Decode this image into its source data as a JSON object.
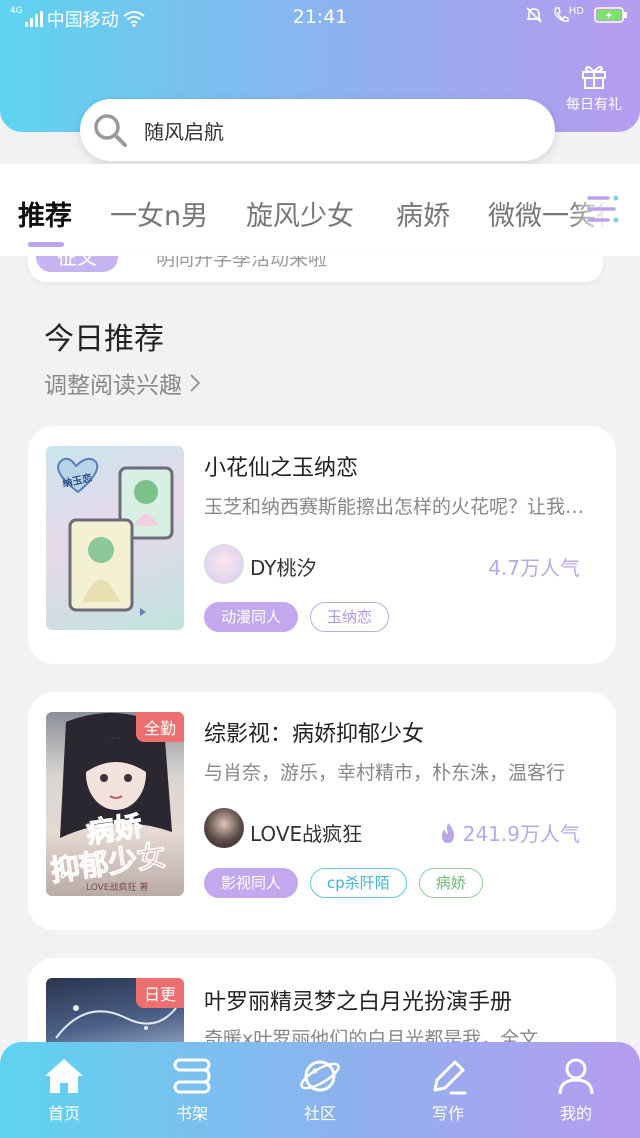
{
  "status_bar": {
    "network": "4G",
    "carrier": "中国移动",
    "time": "21:41",
    "hd": "HD"
  },
  "header": {
    "gift_label": "每日有礼",
    "search_text": "随风启航"
  },
  "tabs": [
    "推荐",
    "一女n男",
    "旋风少女",
    "病娇",
    "微微一笑很倾城"
  ],
  "banner": {
    "tag": "征文",
    "text": "明同开学季活动来啦"
  },
  "section": {
    "title": "今日推荐",
    "subtitle": "调整阅读兴趣"
  },
  "books": [
    {
      "title": "小花仙之玉纳恋",
      "desc": "玉芝和纳西赛斯能擦出怎样的火花呢？让我们拭目以待",
      "author": "DY桃汐",
      "popularity": "4.7万人气",
      "badge": "",
      "cover_text": "纳玉恋",
      "tags": [
        "动漫同人",
        "玉纳恋"
      ]
    },
    {
      "title": "综影视：病娇抑郁少女",
      "desc": "与肖奈，游乐，幸村精市，朴东洙，温客行",
      "author": "LOVE战疯狂",
      "popularity": "241.9万人气",
      "badge": "全勤",
      "cover_text_1": "病娇",
      "cover_text_2": "抑郁少女",
      "cover_caption": "LOVE战疯狂 著",
      "tags": [
        "影视同人",
        "cp杀阡陌",
        "病娇"
      ]
    },
    {
      "title": "叶罗丽精灵梦之白月光扮演手册",
      "desc": "奇暖x叶罗丽他们的白月光都是我，全文",
      "badge": "日更"
    }
  ],
  "bottom_nav": [
    "首页",
    "书架",
    "社区",
    "写作",
    "我的"
  ],
  "colors": {
    "gradient_start": "#5ed3f0",
    "gradient_end": "#b79cf0",
    "accent_purple": "#c4a8ee",
    "badge_red": "#ee6f6f"
  }
}
